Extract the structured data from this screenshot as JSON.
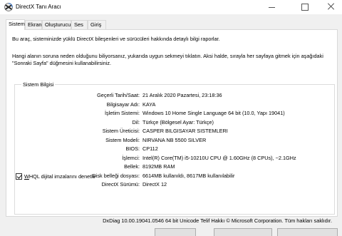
{
  "window": {
    "title": "DirectX Tanı Aracı"
  },
  "tabs": [
    {
      "label": "Sistem"
    },
    {
      "label": "Ekran"
    },
    {
      "label": "Oluşturucu"
    },
    {
      "label": "Ses"
    },
    {
      "label": "Giriş"
    }
  ],
  "panel": {
    "intro": "Bu araç, sisteminizde yüklü DirectX bileşenleri ve sürücüleri hakkında detaylı bilgi raporlar.",
    "hint_line1": "Hangi alanın soruna neden olduğunu biliyorsanız, yukarıda uygun sekmeyi tıklatın. Aksi halde, sırayla her sayfaya gitmek için aşağıdaki",
    "hint_line2": "\"Sonraki Sayfa\" düğmesini kullanabilirsiniz."
  },
  "system_info": {
    "title": "Sistem Bilgisi",
    "rows": [
      {
        "label": "Geçerli Tarih/Saat:",
        "value": "21 Aralık 2020 Pazartesi, 23:18:36"
      },
      {
        "label": "Bilgisayar Adı:",
        "value": "KAYA"
      },
      {
        "label": "İşletim Sistemi:",
        "value": "Windows 10 Home Single Language 64 bit (10.0, Yapı 19041)"
      },
      {
        "label": "Dil:",
        "value": "Türkçe (Bölgesel Ayar: Türkçe)"
      },
      {
        "label": "Sistem Üreticisi:",
        "value": "CASPER BILGISAYAR SISTEMLERI"
      },
      {
        "label": "Sistem Modeli:",
        "value": "NIRVANA NB 5500 SILVER"
      },
      {
        "label": "BIOS:",
        "value": "CP112"
      },
      {
        "label": "İşlemci:",
        "value": "Intel(R) Core(TM) i5-10210U CPU @ 1.60GHz (8 CPUs), ~2.1GHz"
      },
      {
        "label": "Bellek:",
        "value": "8192MB RAM"
      },
      {
        "label": "Disk belleği dosyası:",
        "value": "6614MB kullanıldı, 8617MB kullanılabilir"
      },
      {
        "label": "DirectX Sürümü:",
        "value": "DirectX 12"
      }
    ]
  },
  "whql": {
    "label_underlined": "W",
    "label_rest": "HQL dijital imzalarını denetle",
    "checked": true
  },
  "footer": {
    "text": "DxDiag 10.00.19041.0546 64 bit Unicode  Telif Hakkı © Microsoft Corporation. Tüm hakları saklıdır."
  },
  "colors": {
    "background": "#f0f0f0",
    "panel": "#ffffff",
    "border": "#d9d9d9"
  }
}
